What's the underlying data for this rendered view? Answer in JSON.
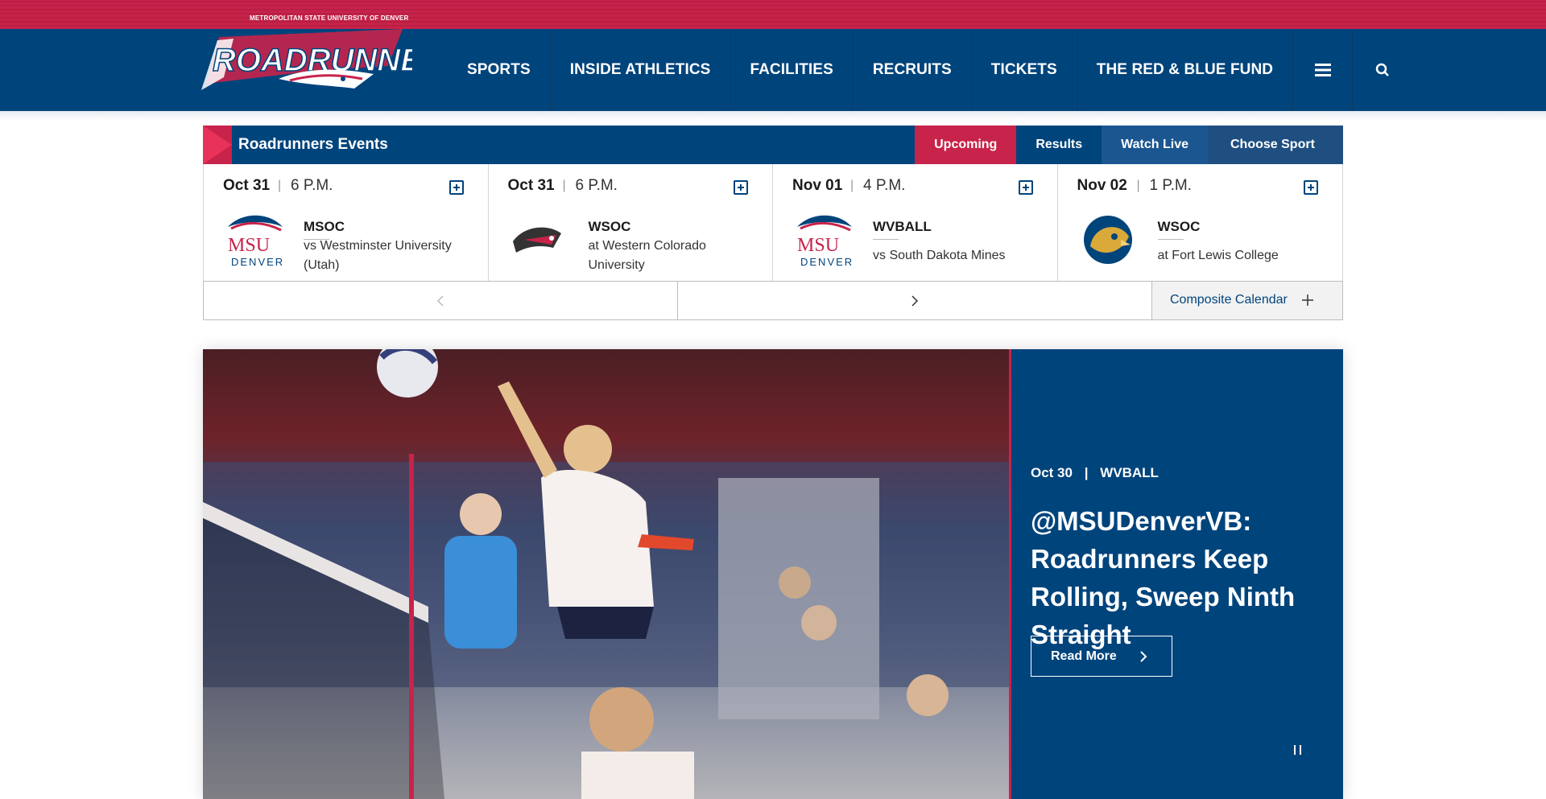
{
  "header": {
    "logo_top_text": "METROPOLITAN STATE UNIVERSITY OF DENVER",
    "logo_word": "ROADRUNNERS",
    "nav": [
      "SPORTS",
      "INSIDE ATHLETICS",
      "FACILITIES",
      "RECRUITS",
      "TICKETS",
      "THE RED & BLUE FUND"
    ],
    "menu_icon": "hamburger-icon",
    "search_icon": "search-icon"
  },
  "events": {
    "title": "Roadrunners Events",
    "tabs": [
      "Upcoming",
      "Results",
      "Watch Live",
      "Choose Sport"
    ],
    "cards": [
      {
        "date": "Oct 31",
        "time": "6 P.M.",
        "sport": "MSOC",
        "opponent": "vs Westminster University (Utah)",
        "logo": "msu-denver-logo"
      },
      {
        "date": "Oct 31",
        "time": "6 P.M.",
        "sport": "WSOC",
        "opponent": "at Western Colorado University",
        "logo": "western-colorado-logo"
      },
      {
        "date": "Nov 01",
        "time": "4 P.M.",
        "sport": "WVBALL",
        "opponent": "vs South Dakota Mines",
        "logo": "msu-denver-logo"
      },
      {
        "date": "Nov 02",
        "time": "1 P.M.",
        "sport": "WSOC",
        "opponent": "at Fort Lewis College",
        "logo": "fort-lewis-logo"
      }
    ],
    "composite_calendar": "Composite Calendar"
  },
  "hero": {
    "date": "Oct 30",
    "sport": "WVBALL",
    "separator": "|",
    "title": "@MSUDenverVB: Roadrunners Keep Rolling, Sweep Ninth Straight",
    "read_more": "Read More"
  },
  "colors": {
    "navy": "#00447c",
    "red": "#c8234a"
  }
}
